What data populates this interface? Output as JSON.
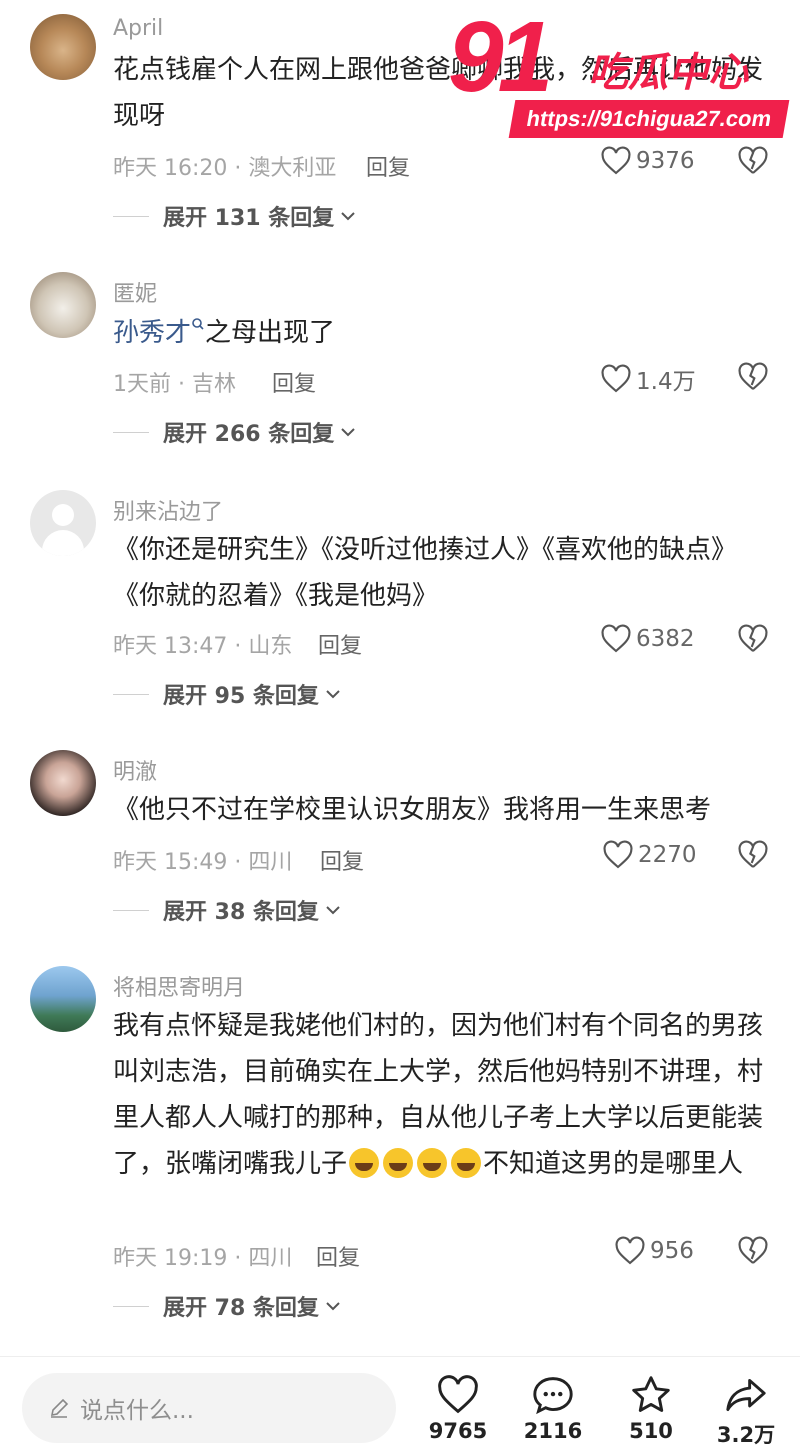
{
  "watermark": {
    "number": "91",
    "title": "吃瓜中心",
    "url": "https://91chigua27.com"
  },
  "comments": [
    {
      "username": "April",
      "text": "花点钱雇个人在网上跟他爸爸卿卿我我，然后再让他妈发现呀",
      "time_location": "昨天 16:20 · 澳大利亚",
      "reply_label": "回复",
      "likes": "9376",
      "expand": "展开 131 条回复"
    },
    {
      "username": "匿妮",
      "mention": "孙秀才",
      "text": "之母出现了",
      "time_location": "1天前 · 吉林",
      "reply_label": "回复",
      "likes": "1.4万",
      "expand": "展开 266 条回复"
    },
    {
      "username": "别来沾边了",
      "text": "《你还是研究生》《没听过他揍过人》《喜欢他的缺点》《你就的忍着》《我是他妈》",
      "time_location": "昨天 13:47 · 山东",
      "reply_label": "回复",
      "likes": "6382",
      "expand": "展开 95 条回复"
    },
    {
      "username": "明澈",
      "text": "《他只不过在学校里认识女朋友》我将用一生来思考",
      "time_location": "昨天 15:49 · 四川",
      "reply_label": "回复",
      "likes": "2270",
      "expand": "展开 38 条回复"
    },
    {
      "username": "将相思寄明月",
      "text_before": "我有点怀疑是我姥他们村的，因为他们村有个同名的男孩叫刘志浩，目前确实在上大学，然后他妈特别不讲理，村里人都人人喊打的那种，自从他儿子考上大学以后更能装了，张嘴闭嘴我儿子",
      "text_after": "不知道这男的是哪里人",
      "emoji_icon": "laughing-crying-emoji",
      "time_location": "昨天 19:19 · 四川",
      "reply_label": "回复",
      "likes": "956",
      "expand": "展开 78 条回复"
    }
  ],
  "bottom_bar": {
    "input_placeholder": "说点什么...",
    "like_count": "9765",
    "comment_count": "2116",
    "favorite_count": "510",
    "share_count": "3.2万"
  },
  "colors": {
    "accent_watermark": "#f0204b",
    "mention": "#3a5a8c"
  }
}
